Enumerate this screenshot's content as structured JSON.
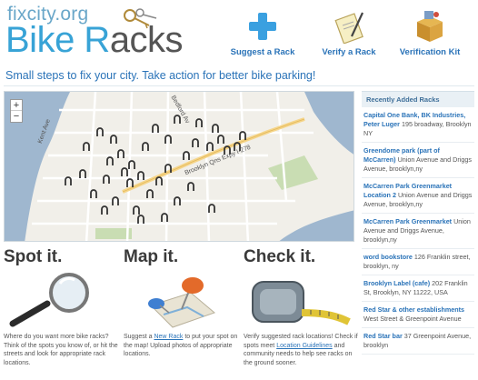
{
  "logo": {
    "top_text": "fixcity.org",
    "big_first": "Bike R",
    "big_second": "acks",
    "keys_icon": "keys-icon"
  },
  "nav": [
    {
      "label": "Suggest a Rack",
      "icon": "plus-icon"
    },
    {
      "label": "Verify a Rack",
      "icon": "clipboard-check-icon"
    },
    {
      "label": "Verification Kit",
      "icon": "box-kit-icon"
    }
  ],
  "tagline": "Small steps to fix your city. Take action for better bike parking!",
  "map": {
    "zoom_in": "+",
    "zoom_out": "−",
    "streets": [
      "Brooklyn Qns Expy I-278",
      "Broadway",
      "Kent Ave",
      "Bedford Av"
    ]
  },
  "sidebar": {
    "title": "Recently Added Racks",
    "racks": [
      {
        "name": "Capital One Bank, BK Industries, Peter Luger",
        "address": "195 broadway, Brooklyn NY"
      },
      {
        "name": "Greendome park (part of McCarren)",
        "address": "Union Avenue and Driggs Avenue, brooklyn,ny"
      },
      {
        "name": "McCarren Park Greenmarket Location 2",
        "address": "Union Avenue and Driggs Avenue, brooklyn,ny"
      },
      {
        "name": "McCarren Park Greenmarket",
        "address": "Union Avenue and Driggs Avenue, brooklyn,ny"
      },
      {
        "name": "word bookstore",
        "address": "126 Franklin street, brooklyn, ny"
      },
      {
        "name": "Brooklyn Label (cafe)",
        "address": "202 Franklin St, Brooklyn, NY 11222, USA"
      },
      {
        "name": "Red Star & other establishments",
        "address": "West Street & Greenpoint Avenue"
      },
      {
        "name": "Red Star bar",
        "address": "37 Greenpoint Avenue, brooklyn"
      }
    ]
  },
  "columns": [
    {
      "title": "Spot it.",
      "icon": "magnifier-icon",
      "text": "Where do you want more bike racks? Think of the spots you know of, or hit the streets and look for appropriate rack locations."
    },
    {
      "title": "Map it.",
      "icon": "map-pin-icon",
      "text_before": "Suggest a ",
      "link": "New Rack",
      "text_after": " to put your spot on the map! Upload photos of appropriate locations."
    },
    {
      "title": "Check it.",
      "icon": "tape-measure-icon",
      "text_before": "Verify suggested rack locations! Check if spots meet ",
      "link": "Location Guidelines",
      "text_after": " and community needs to help see racks on the ground sooner."
    }
  ],
  "colors": {
    "brand_blue": "#38a3d6",
    "link_blue": "#2a73b8",
    "water": "#9fb7cf",
    "park": "#c9ddb3"
  }
}
